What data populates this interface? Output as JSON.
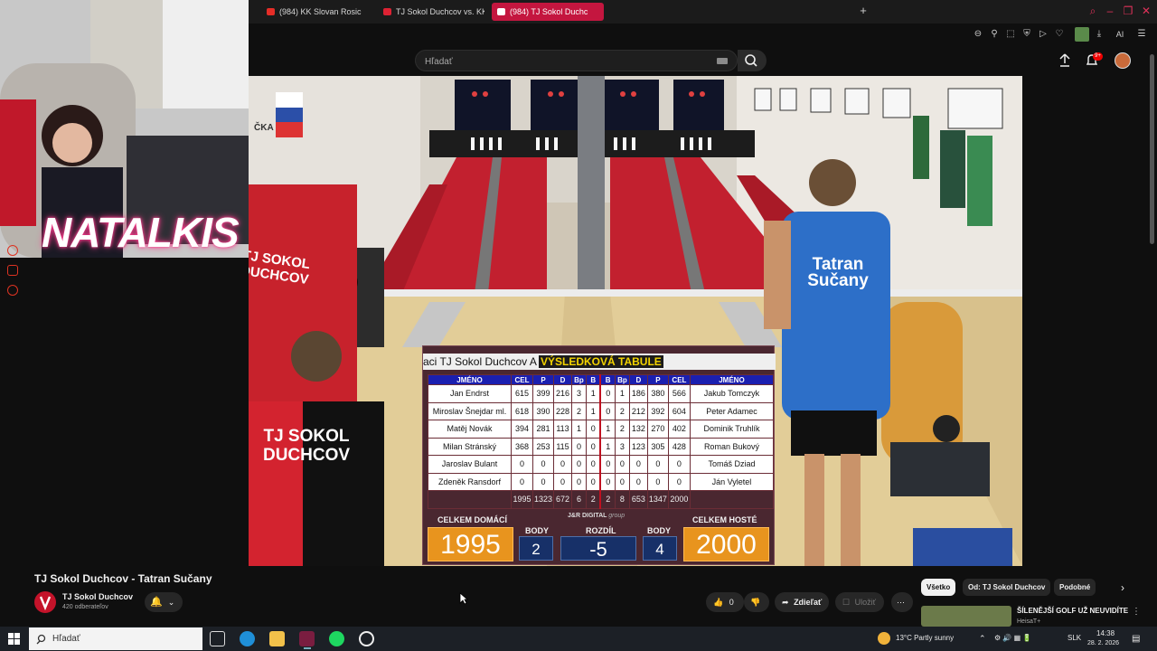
{
  "browser": {
    "tabs": [
      {
        "label": "(984) KK Slovan Rosic"
      },
      {
        "label": "TJ Sokol Duchcov vs. KK"
      },
      {
        "label": "(984) TJ Sokol Duchc"
      }
    ],
    "new_tab": "+",
    "toolbar_ai": "AI"
  },
  "youtube": {
    "search_placeholder": "Hľadať",
    "notif_count": "9+"
  },
  "stream": {
    "overlay_name": "NATALKIS"
  },
  "video_text": {
    "shirt_left": "TJ SOKOL\nDUCHCOV",
    "shirt_right": "Tatran\nSučany",
    "banner": "ČKA"
  },
  "scoreboard": {
    "marquee": "aci TJ Sokol Duchcov A",
    "title": "VÝSLEDKOVÁ TABULE",
    "headers": [
      "JMÉNO",
      "CEL",
      "P",
      "D",
      "Bp",
      "B",
      "B",
      "Bp",
      "D",
      "P",
      "CEL",
      "JMÉNO"
    ],
    "rows": [
      [
        "Jan Endrst",
        "615",
        "399",
        "216",
        "3",
        "1",
        "0",
        "1",
        "186",
        "380",
        "566",
        "Jakub Tomczyk"
      ],
      [
        "Miroslav Šnejdar ml.",
        "618",
        "390",
        "228",
        "2",
        "1",
        "0",
        "2",
        "212",
        "392",
        "604",
        "Peter Adamec"
      ],
      [
        "Matěj Novák",
        "394",
        "281",
        "113",
        "1",
        "0",
        "1",
        "2",
        "132",
        "270",
        "402",
        "Dominik Truhlík"
      ],
      [
        "Milan Stránský",
        "368",
        "253",
        "115",
        "0",
        "0",
        "1",
        "3",
        "123",
        "305",
        "428",
        "Roman Bukový"
      ],
      [
        "Jaroslav Bulant",
        "0",
        "0",
        "0",
        "0",
        "0",
        "0",
        "0",
        "0",
        "0",
        "0",
        "Tomáš Dziad"
      ],
      [
        "Zdeněk Ransdorf",
        "0",
        "0",
        "0",
        "0",
        "0",
        "0",
        "0",
        "0",
        "0",
        "0",
        "Ján Vyletel"
      ]
    ],
    "totals": [
      "",
      "1995",
      "1323",
      "672",
      "6",
      "2",
      "2",
      "8",
      "653",
      "1347",
      "2000",
      ""
    ],
    "label_home": "CELKEM DOMÁCÍ",
    "label_away": "CELKEM HOSTÉ",
    "label_points": "BODY",
    "label_diff": "ROZDÍL",
    "brand": "J&R DIGITAL",
    "brand_suffix": "group",
    "home_total": "1995",
    "away_total": "2000",
    "home_points": "2",
    "away_points": "4",
    "difference": "-5"
  },
  "video_meta": {
    "title": "TJ Sokol Duchcov - Tatran Sučany",
    "channel": "TJ Sokol Duchcov",
    "subscribers": "420 odberateľov",
    "likes": "0",
    "share": "Zdieľať",
    "save": "Uložiť"
  },
  "chips": [
    "Všetko",
    "Od: TJ Sokol Duchcov",
    "Podobné"
  ],
  "recommendation": {
    "title": "ŠÍLENĚJŠÍ GOLF UŽ NEUVIDÍTE",
    "channel": "HeisaT+"
  },
  "taskbar": {
    "search": "Hľadať",
    "weather": "13°C  Partly sunny",
    "lang": "SLK",
    "time": "14:38",
    "date": "28. 2. 2026"
  }
}
